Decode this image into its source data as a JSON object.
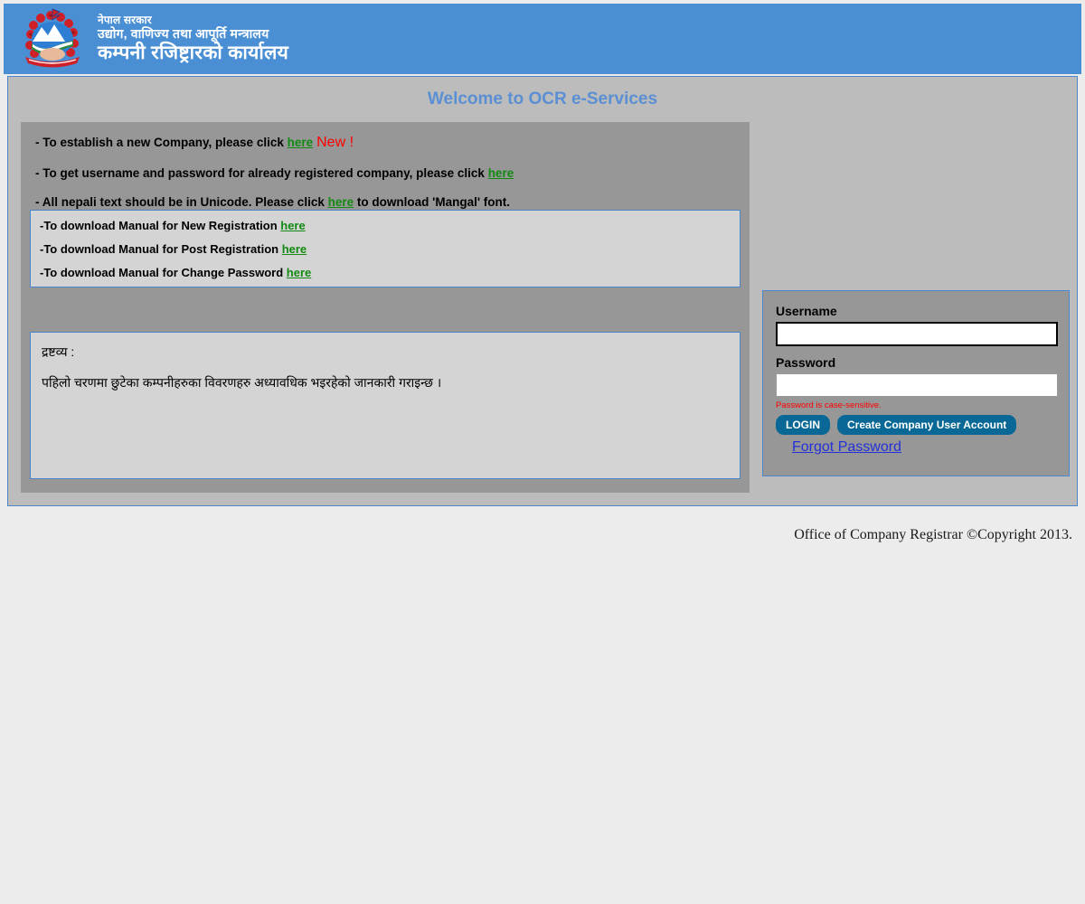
{
  "header": {
    "emblem_icon": "nepal-government-emblem-icon",
    "line1": "नेपाल सरकार",
    "line2": "उद्योग, वाणिज्य तथा आपूर्ति मन्त्रालय",
    "line3": "कम्पनी रजिष्ट्रारको कार्यालय",
    "banner_color": "#4a8fd4"
  },
  "page": {
    "title": "Welcome to OCR e-Services",
    "title_color": "#5b8fd4",
    "panel_bg": "#bcbcbc",
    "border_color": "#4a86c8"
  },
  "info": {
    "line1_pre": "- To establish a new Company, please click ",
    "line1_link": "here",
    "line1_badge": "New !",
    "line2_pre": "- To get username and password for already registered company, please click ",
    "line2_link": "here",
    "line3_pre": "- All nepali text should be in Unicode. Please click ",
    "line3_link": "here",
    "line3_post": " to download 'Mangal' font.",
    "link_color": "#128a12",
    "badge_color": "#ff0000"
  },
  "manuals": {
    "items": [
      {
        "text": "-To download Manual for New Registration ",
        "link": "here"
      },
      {
        "text": "-To download Manual for Post Registration ",
        "link": "here"
      },
      {
        "text": "-To download Manual for Change Password ",
        "link": "here"
      }
    ]
  },
  "notice": {
    "title": "द्रष्टव्य :",
    "body": "पहिलो चरणमा छुटेका कम्पनीहरुका विवरणहरु अध्यावधिक भइरहेको जानकारी गराइन्छ ।"
  },
  "login": {
    "username_label": "Username",
    "username_value": "",
    "username_placeholder": "",
    "password_label": "Password",
    "password_value": "",
    "password_placeholder": "",
    "password_hint": "Password is case-sensitive.",
    "login_button": "LOGIN",
    "create_account_button": "Create Company User Account",
    "forgot_link": "Forgot Password",
    "button_color": "#0a6896",
    "hint_color": "#ff0000",
    "link_color": "#2431d8"
  },
  "footer": {
    "text": "Office of Company Registrar ©Copyright 2013."
  }
}
